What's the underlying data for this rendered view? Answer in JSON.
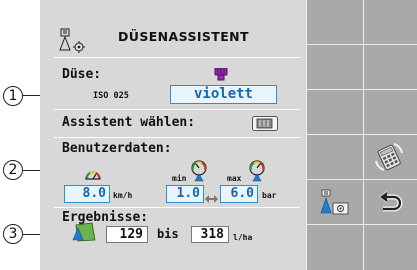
{
  "title": "DÜSENASSISTENT",
  "duese": {
    "label": "Düse:",
    "iso_code": "ISO 025",
    "color_value": "violett",
    "nozzle_color": "#9a2bb3"
  },
  "assistent": {
    "label": "Assistent wählen:"
  },
  "benutzerdaten": {
    "label": "Benutzerdaten:",
    "min_label": "min",
    "max_label": "max",
    "speed_value": "8.0",
    "speed_unit": "km/h",
    "pressure_min": "1.0",
    "pressure_max": "6.0",
    "pressure_unit": "bar"
  },
  "ergebnisse": {
    "label": "Ergebnisse:",
    "from_value": "129",
    "bis_label": "bis",
    "to_value": "318",
    "unit": "l/ha"
  },
  "callouts": [
    "1",
    "2",
    "3"
  ],
  "icons": {
    "header": "nozzle-settings-icon",
    "assistant": "assistant-select-icon",
    "speed": "speedometer-icon",
    "pressure_min": "pressure-gauge-min-icon",
    "pressure_max": "pressure-gauge-max-icon",
    "result": "field-application-icon",
    "softkey_calculator": "calculator-icon",
    "softkey_nozzle_settings": "nozzle-settings-softkey-icon",
    "softkey_back": "back-arrow-icon"
  },
  "colors": {
    "panel": "#d8d8d8",
    "softkey_bg": "#a9a9a9",
    "value_text": "#1367b5",
    "value_border": "#2d8fd1"
  }
}
